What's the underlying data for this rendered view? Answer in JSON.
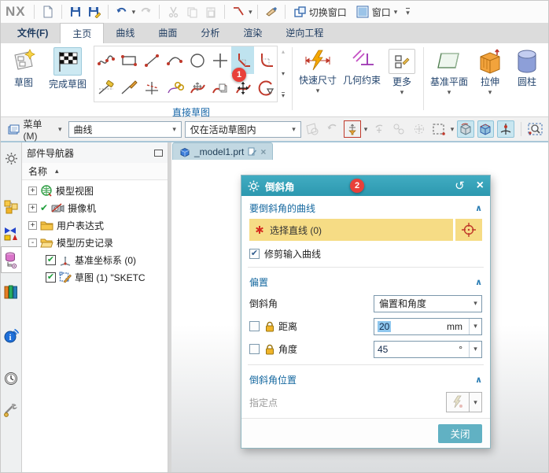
{
  "titlebar": {
    "logo": "NX",
    "switch_window": "切换窗口",
    "window": "窗口"
  },
  "tabs": [
    {
      "label": "文件(F)"
    },
    {
      "label": "主页"
    },
    {
      "label": "曲线"
    },
    {
      "label": "曲面"
    },
    {
      "label": "分析"
    },
    {
      "label": "渲染"
    },
    {
      "label": "逆向工程"
    }
  ],
  "ribbon": {
    "sketch": "草图",
    "finish_sketch": "完成草图",
    "group_direct_sketch": "直接草图",
    "quick_dimension": "快速尺寸",
    "geometric_constraints": "几何约束",
    "more": "更多",
    "datum_plane": "基准平面",
    "extrude": "拉伸",
    "cylinder": "圆柱",
    "badge_1": "1"
  },
  "selection_bar": {
    "menu": "菜单(M)",
    "type_filter": "曲线",
    "scope_filter": "仅在活动草图内"
  },
  "navigator": {
    "title": "部件导航器",
    "name_column": "名称",
    "items": [
      {
        "label": "模型视图",
        "expand": "+"
      },
      {
        "label": "摄像机",
        "expand": "+"
      },
      {
        "label": "用户表达式",
        "expand": "+"
      },
      {
        "label": "模型历史记录",
        "expand": "-"
      },
      {
        "label": "基准坐标系 (0)"
      },
      {
        "label": "草图 (1) \"SKETC"
      }
    ]
  },
  "canvas": {
    "tab_title": "_model1.prt"
  },
  "dialog": {
    "title": "倒斜角",
    "badge_2": "2",
    "curves_section": "要倒斜角的曲线",
    "select_line": "选择直线 (0)",
    "trim_input_curves": "修剪输入曲线",
    "offset_section": "偏置",
    "chamfer": "倒斜角",
    "offset_mode": "偏置和角度",
    "distance": "距离",
    "distance_value": "20",
    "distance_unit": "mm",
    "angle": "角度",
    "angle_value": "45",
    "angle_unit": "°",
    "position_section": "倒斜角位置",
    "specify_point": "指定点",
    "close": "关闭"
  },
  "icons": {
    "caret_down": "▾",
    "caret_up": "▴",
    "sort_asc": "▲",
    "collapse_chevron": "∧",
    "reset": "↺",
    "close": "×",
    "check": "✔",
    "maximize": "",
    "plus": "+"
  },
  "colors": {
    "accent_teal": "#35a3ba",
    "selection_yellow": "#f6dc85",
    "badge_red": "#e8403a",
    "section_blue": "#12669e"
  }
}
